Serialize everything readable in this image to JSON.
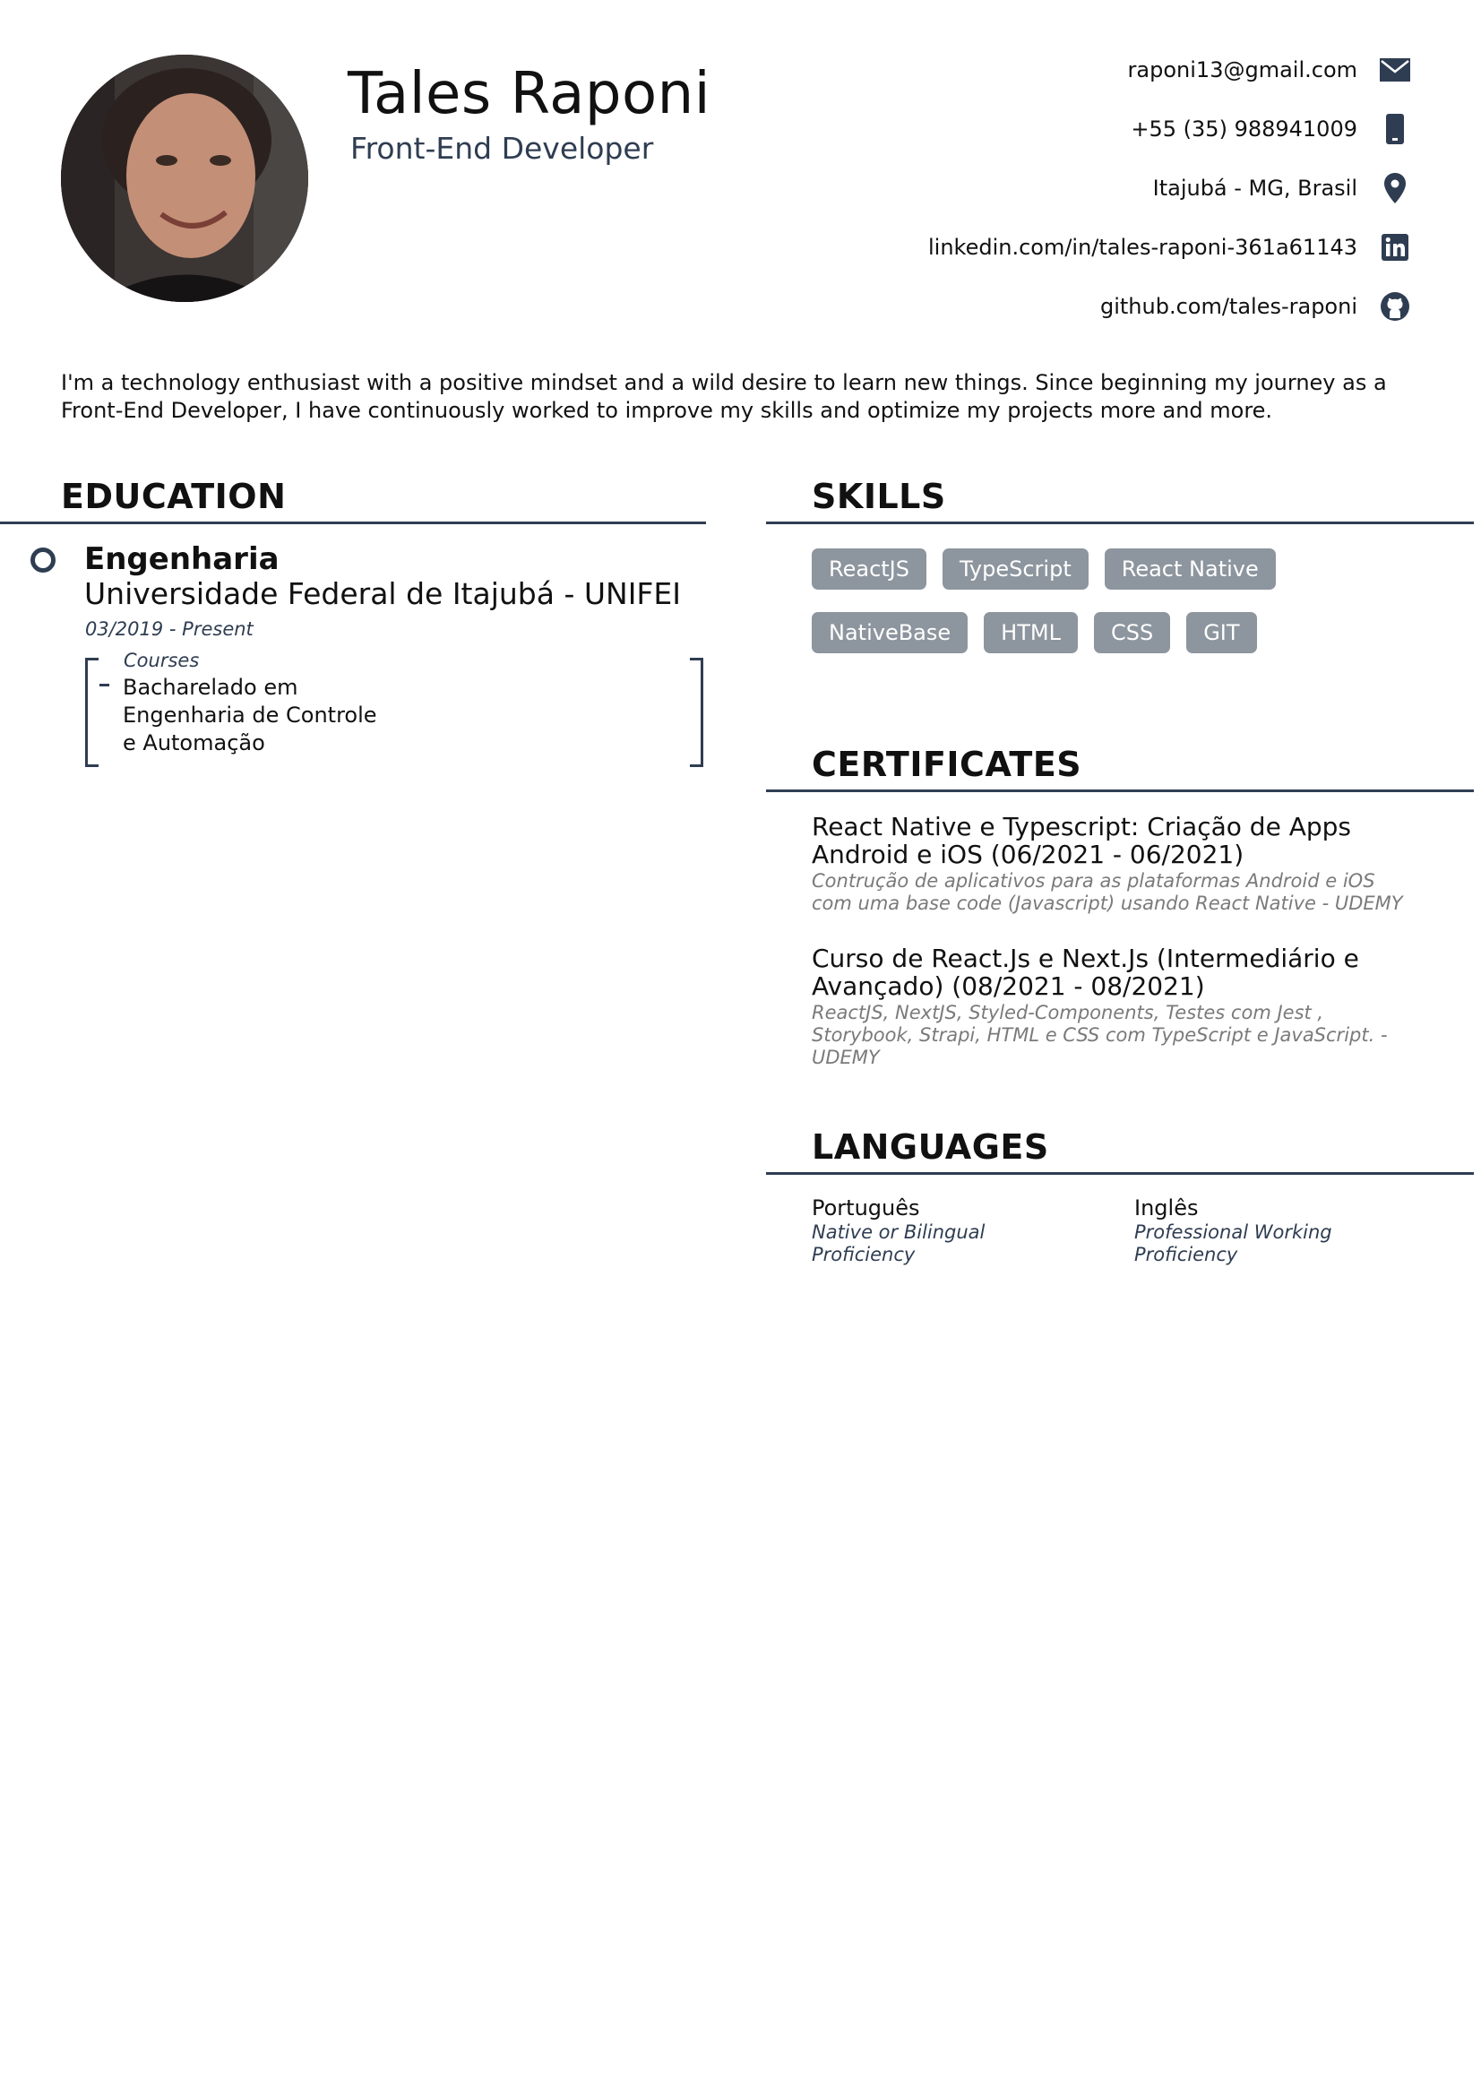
{
  "header": {
    "name": "Tales Raponi",
    "title": "Front-End Developer",
    "photo_alt": "profile photo"
  },
  "contacts": [
    {
      "text": "raponi13@gmail.com",
      "icon": "email-icon"
    },
    {
      "text": "+55 (35) 988941009",
      "icon": "phone-icon"
    },
    {
      "text": "Itajubá - MG, Brasil",
      "icon": "location-pin-icon"
    },
    {
      "text": "linkedin.com/in/tales-raponi-361a61143",
      "icon": "linkedin-icon"
    },
    {
      "text": "github.com/tales-raponi",
      "icon": "github-icon"
    }
  ],
  "summary": "I'm a technology enthusiast with a positive mindset and a wild desire to learn new things. Since beginning my journey as a Front-End Developer, I have continuously worked to improve my skills and optimize my projects more and more.",
  "education": {
    "heading": "EDUCATION",
    "items": [
      {
        "degree": "Engenharia",
        "school": "Universidade Federal de Itajubá - UNIFEI",
        "dates": "03/2019 - Present",
        "courses_label": "Courses",
        "courses": [
          "Bacharelado em Engenharia de Controle e Automação"
        ]
      }
    ]
  },
  "skills": {
    "heading": "SKILLS",
    "items": [
      "ReactJS",
      "TypeScript",
      "React Native",
      "NativeBase",
      "HTML",
      "CSS",
      "GIT"
    ]
  },
  "certificates": {
    "heading": "CERTIFICATES",
    "items": [
      {
        "title": "React Native e Typescript: Criação de Apps Android e iOS (06/2021 - 06/2021)",
        "description": "Contrução de aplicativos para as plataformas Android e iOS com uma base code (Javascript) usando React Native - UDEMY"
      },
      {
        "title": "Curso de React.Js e Next.Js (Intermediário e Avançado) (08/2021 - 08/2021)",
        "description": "ReactJS, NextJS, Styled-Components, Testes com Jest , Storybook, Strapi, HTML e CSS com TypeScript e JavaScript. - UDEMY"
      }
    ]
  },
  "languages": {
    "heading": "LANGUAGES",
    "items": [
      {
        "name": "Português",
        "level": "Native or Bilingual Proficiency"
      },
      {
        "name": "Inglês",
        "level": "Professional Working Proficiency"
      }
    ]
  },
  "colors": {
    "accent": "#2f3d52",
    "skill_chip": "#8d959e",
    "muted_text": "#7a7a7a"
  }
}
